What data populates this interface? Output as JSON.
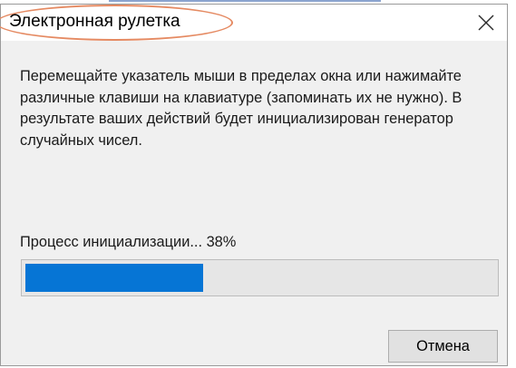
{
  "dialog": {
    "title": "Электронная рулетка",
    "close_icon": "close-icon",
    "message": "Перемещайте указатель мыши в пределах окна или нажимайте различные клавиши на клавиатуре (запоминать их не нужно). В результате ваших действий будет инициализирован генератор случайных чисел.",
    "progress_label": "Процесс инициализации... 38%",
    "progress_fraction": 0.38,
    "cancel_label": "Отмена"
  },
  "colors": {
    "progress_fill": "#0675d5",
    "highlight_outline": "#e58a62"
  }
}
